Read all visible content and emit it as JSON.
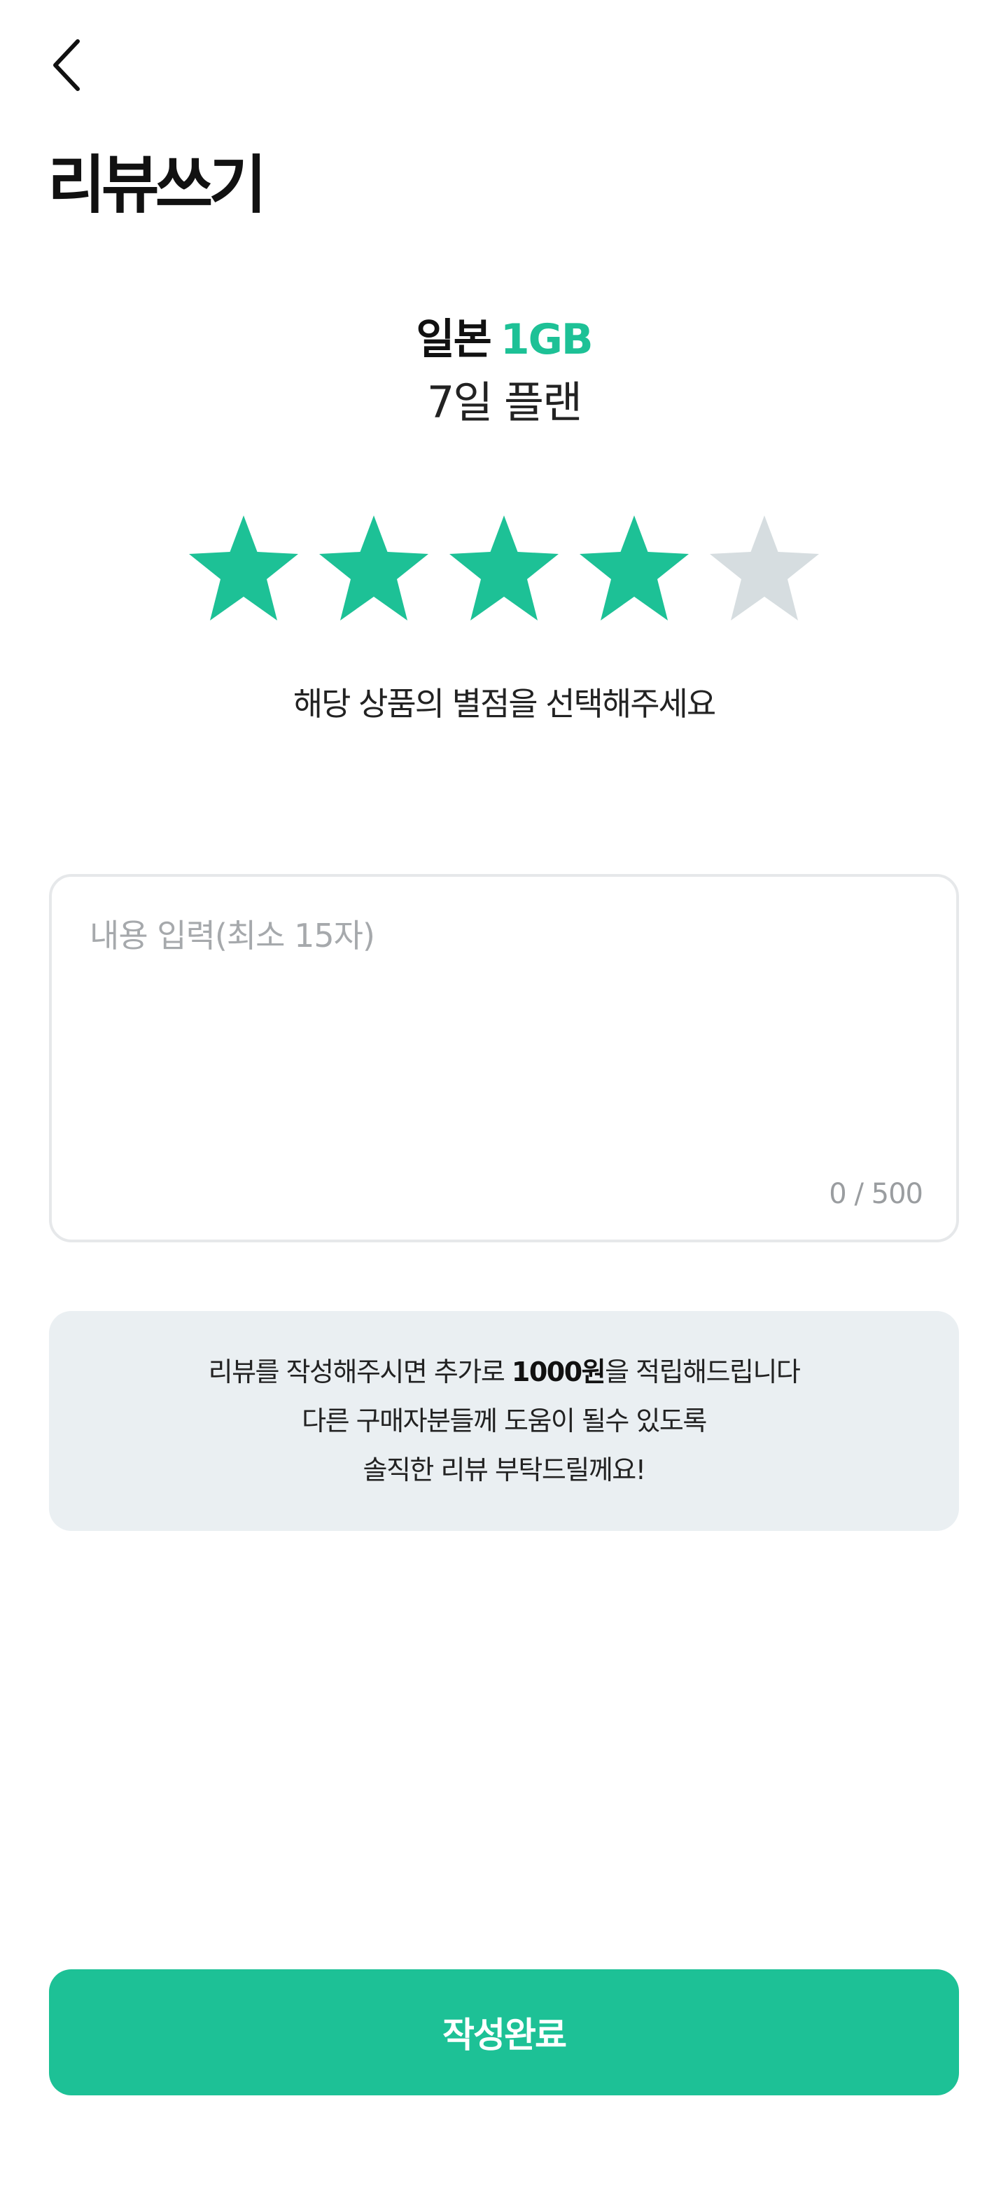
{
  "header": {
    "back_icon": "chevron-left-icon",
    "title": "리뷰쓰기"
  },
  "product": {
    "country": "일본",
    "data": "1GB",
    "plan": "7일 플랜"
  },
  "rating": {
    "value": 4,
    "max": 5,
    "star_icon": "star-icon",
    "hint": "해당 상품의 별점을 선택해주세요"
  },
  "review": {
    "value": "",
    "placeholder": "내용 입력(최소 15자)",
    "char_count": "0 / 500"
  },
  "info": {
    "line1_before": "리뷰를 작성해주시면 추가로 ",
    "line1_amount": "1000원",
    "line1_after": "을 적립해드립니다",
    "line2": "다른 구매자분들께 도움이 될수 있도록",
    "line3": "솔직한 리뷰 부탁드릴께요!"
  },
  "footer": {
    "submit_label": "작성완료"
  },
  "colors": {
    "accent": "#1dc196",
    "star_inactive": "#d6dde0",
    "info_bg": "#eaeff2",
    "border": "#e6e8ea"
  }
}
